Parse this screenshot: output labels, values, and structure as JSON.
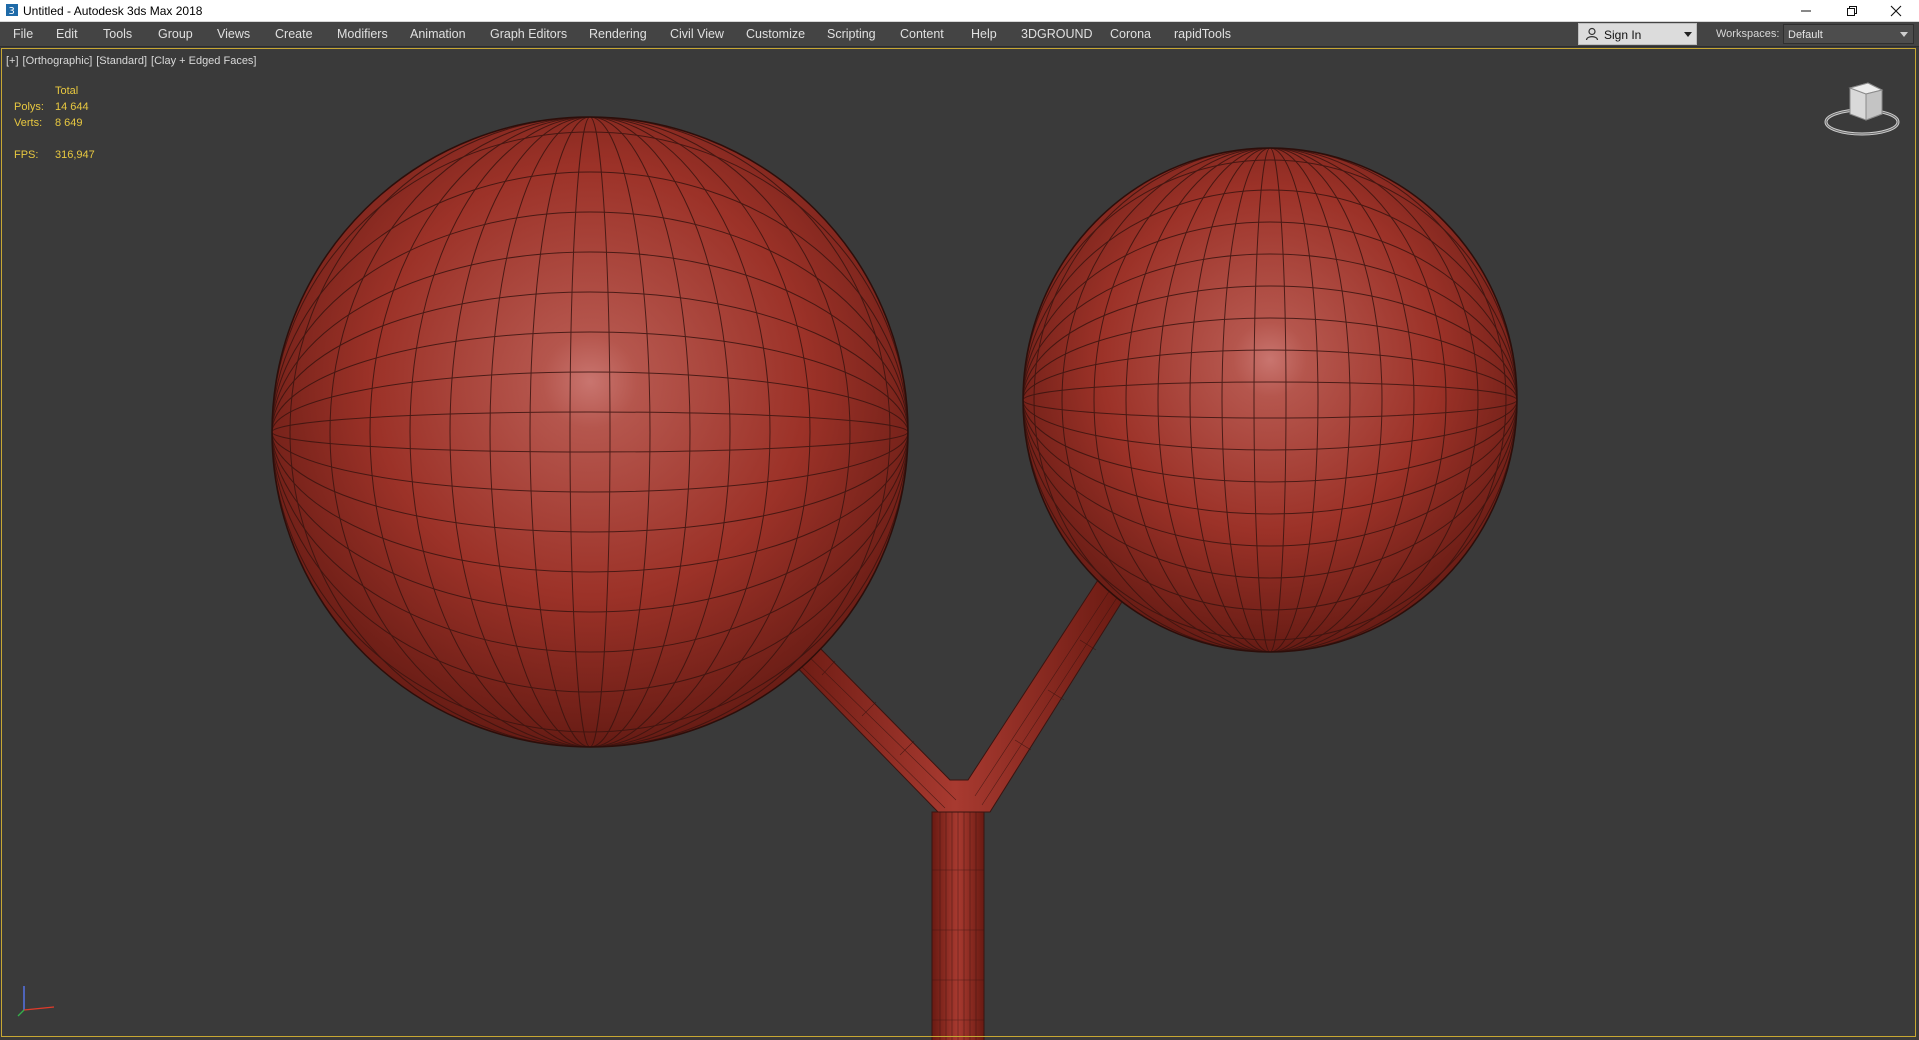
{
  "window": {
    "title": "Untitled - Autodesk 3ds Max 2018",
    "minimize_icon": "minimize-icon",
    "restore_icon": "restore-icon",
    "close_icon": "close-icon"
  },
  "menu": [
    {
      "label": "File"
    },
    {
      "label": "Edit"
    },
    {
      "label": "Tools"
    },
    {
      "label": "Group"
    },
    {
      "label": "Views"
    },
    {
      "label": "Create"
    },
    {
      "label": "Modifiers"
    },
    {
      "label": "Animation"
    },
    {
      "label": "Graph Editors"
    },
    {
      "label": "Rendering"
    },
    {
      "label": "Civil View"
    },
    {
      "label": "Customize"
    },
    {
      "label": "Scripting"
    },
    {
      "label": "Content"
    },
    {
      "label": "Help"
    },
    {
      "label": "3DGROUND"
    },
    {
      "label": "Corona"
    },
    {
      "label": "rapidTools"
    }
  ],
  "account": {
    "sign_in_label": "Sign In",
    "icon": "user-icon"
  },
  "workspaces": {
    "label": "Workspaces:",
    "value": "Default"
  },
  "viewport": {
    "labels": [
      "[+]",
      "[Orthographic]",
      "[Standard]",
      "[Clay + Edged Faces]"
    ],
    "stats": {
      "header": "Total",
      "polys_label": "Polys:",
      "polys_value": "14 644",
      "verts_label": "Verts:",
      "verts_value": "8 649",
      "fps_label": "FPS:",
      "fps_value": "316,947"
    },
    "viewcube_icon": "viewcube-icon",
    "axis_icon": "axis-tripod-icon"
  },
  "colors": {
    "viewport_bg": "#3a3a3a",
    "menubar_bg": "#444444",
    "stats_text": "#e8c840",
    "active_frame": "#c7a733",
    "clay": "#a83a30",
    "wire": "#3a1410"
  }
}
